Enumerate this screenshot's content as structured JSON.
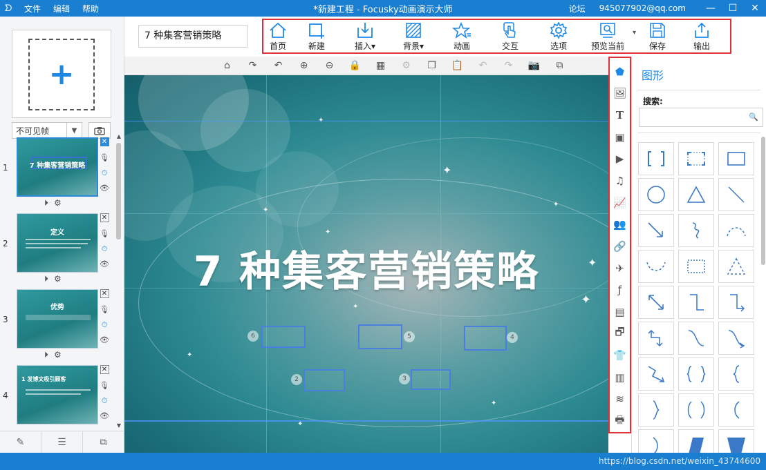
{
  "titlebar": {
    "logo": "ᗤ",
    "menu": [
      "文件",
      "编辑",
      "帮助"
    ],
    "title": "*新建工程 - Focusky动画演示大师",
    "forum": "论坛",
    "account": "945077902@qq.com",
    "minimize": "—",
    "maximize": "☐",
    "close": "✕"
  },
  "left": {
    "add_symbol": "+",
    "frame_select_value": "不可见帧",
    "slides": [
      {
        "num": "1",
        "thumb_title": "7 种集客营销策略"
      },
      {
        "num": "2",
        "thumb_title": "定义"
      },
      {
        "num": "3",
        "thumb_title": "优势"
      },
      {
        "num": "4",
        "thumb_title": "1 发博文吸引顾客"
      }
    ]
  },
  "project_name": "7 种集客营销策略",
  "toolbar": {
    "home": "首页",
    "new": "新建",
    "insert": "插入",
    "background": "背景",
    "animation": "动画",
    "interaction": "交互",
    "options": "选项",
    "preview": "预览当前",
    "save": "保存",
    "export": "输出"
  },
  "canvas": {
    "title": "7 种集客营销策略",
    "bubbles": [
      "6",
      "5",
      "4",
      "2",
      "3"
    ],
    "colors": {
      "accent": "#1b7fd1",
      "frame_border": "#4a7fe0",
      "highlight": "#e0303c"
    }
  },
  "shape_panel": {
    "title": "图形",
    "search_label": "搜索:",
    "search_icon": "🔍"
  },
  "watermark": "https://blog.csdn.net/weixin_43744600"
}
